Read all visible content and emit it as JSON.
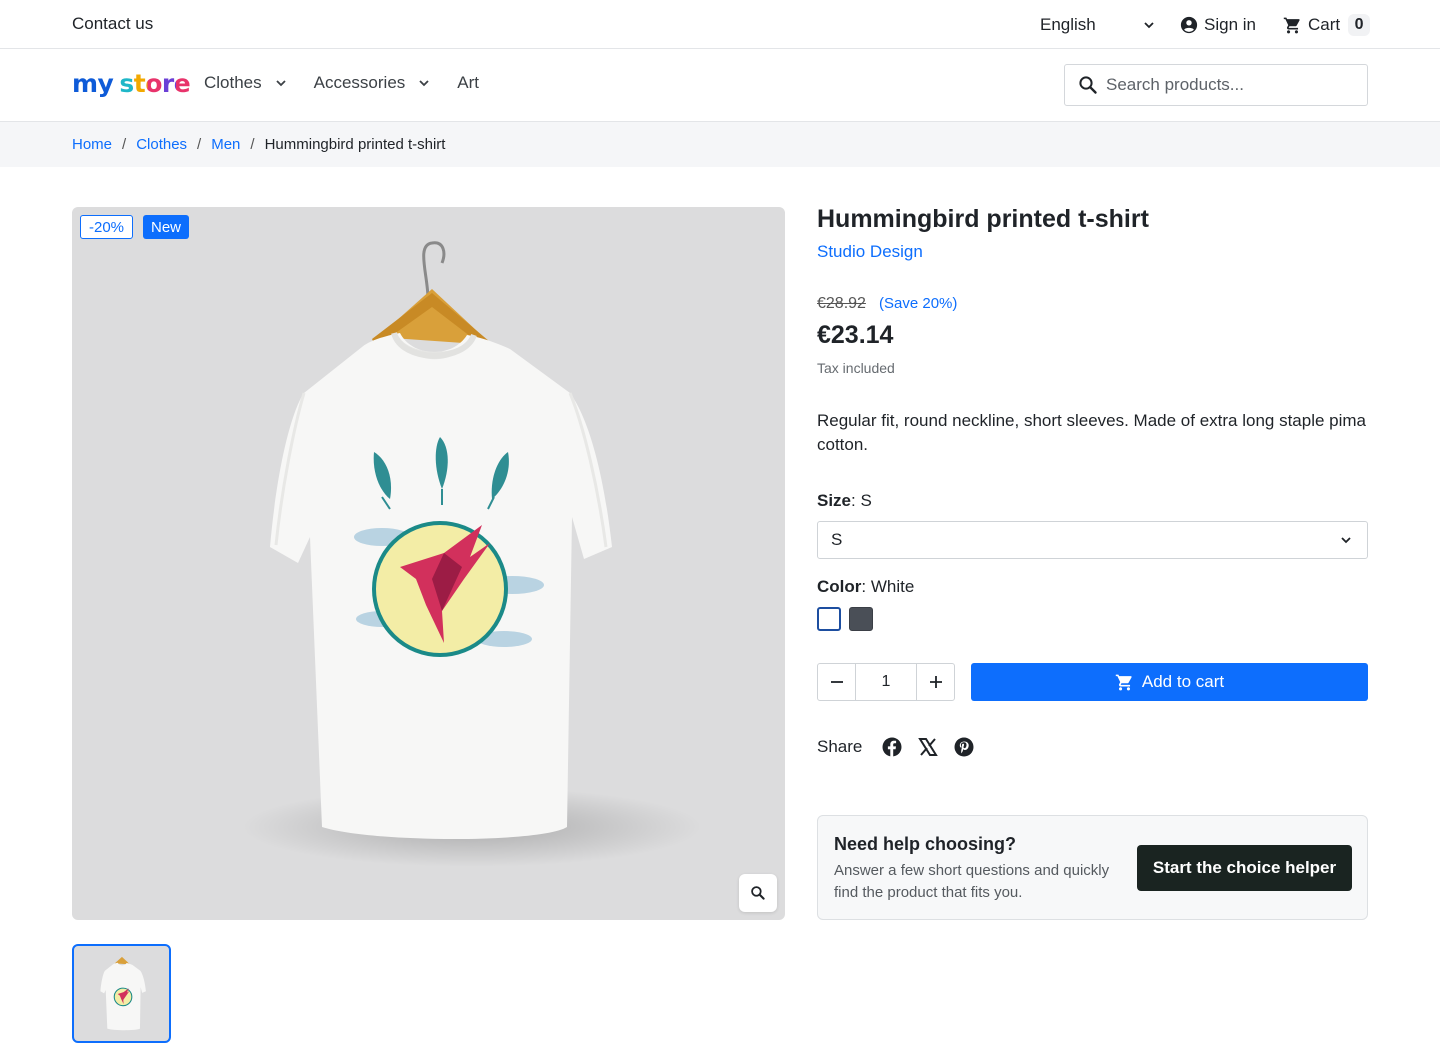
{
  "topbar": {
    "contact": "Contact us",
    "language": "English",
    "sign_in": "Sign in",
    "cart_label": "Cart",
    "cart_count": "0"
  },
  "header": {
    "logo_my": "my",
    "logo_store": "store",
    "nav": [
      {
        "label": "Clothes",
        "has_dropdown": true
      },
      {
        "label": "Accessories",
        "has_dropdown": true
      },
      {
        "label": "Art",
        "has_dropdown": false
      }
    ],
    "search_placeholder": "Search products..."
  },
  "breadcrumb": [
    "Home",
    "Clothes",
    "Men",
    "Hummingbird printed t-shirt"
  ],
  "gallery": {
    "badge_discount": "-20%",
    "badge_new": "New",
    "zoom_icon": "search-icon"
  },
  "product": {
    "title": "Hummingbird printed t-shirt",
    "brand": "Studio Design",
    "regular_price": "€28.92",
    "save": "(Save 20%)",
    "price": "€23.14",
    "tax": "Tax included",
    "description": "Regular fit, round neckline, short sleeves. Made of extra long staple pima cotton.",
    "size_label": "Size",
    "size_value": "S",
    "size_selected": "S",
    "color_label": "Color",
    "color_value": "White",
    "colors": [
      {
        "name": "White",
        "hex": "#ffffff",
        "selected": true
      },
      {
        "name": "Gray",
        "hex": "#4a4f57",
        "selected": false
      }
    ],
    "quantity": "1",
    "add_to_cart": "Add to cart",
    "share_label": "Share",
    "share_icons": [
      "facebook-icon",
      "x-icon",
      "pinterest-icon"
    ]
  },
  "helper": {
    "title": "Need help choosing?",
    "text": "Answer a few short questions and quickly find the product that fits you.",
    "button": "Start the choice helper"
  },
  "colors": {
    "accent": "#0d6efd",
    "helper_button": "#1a2421"
  }
}
